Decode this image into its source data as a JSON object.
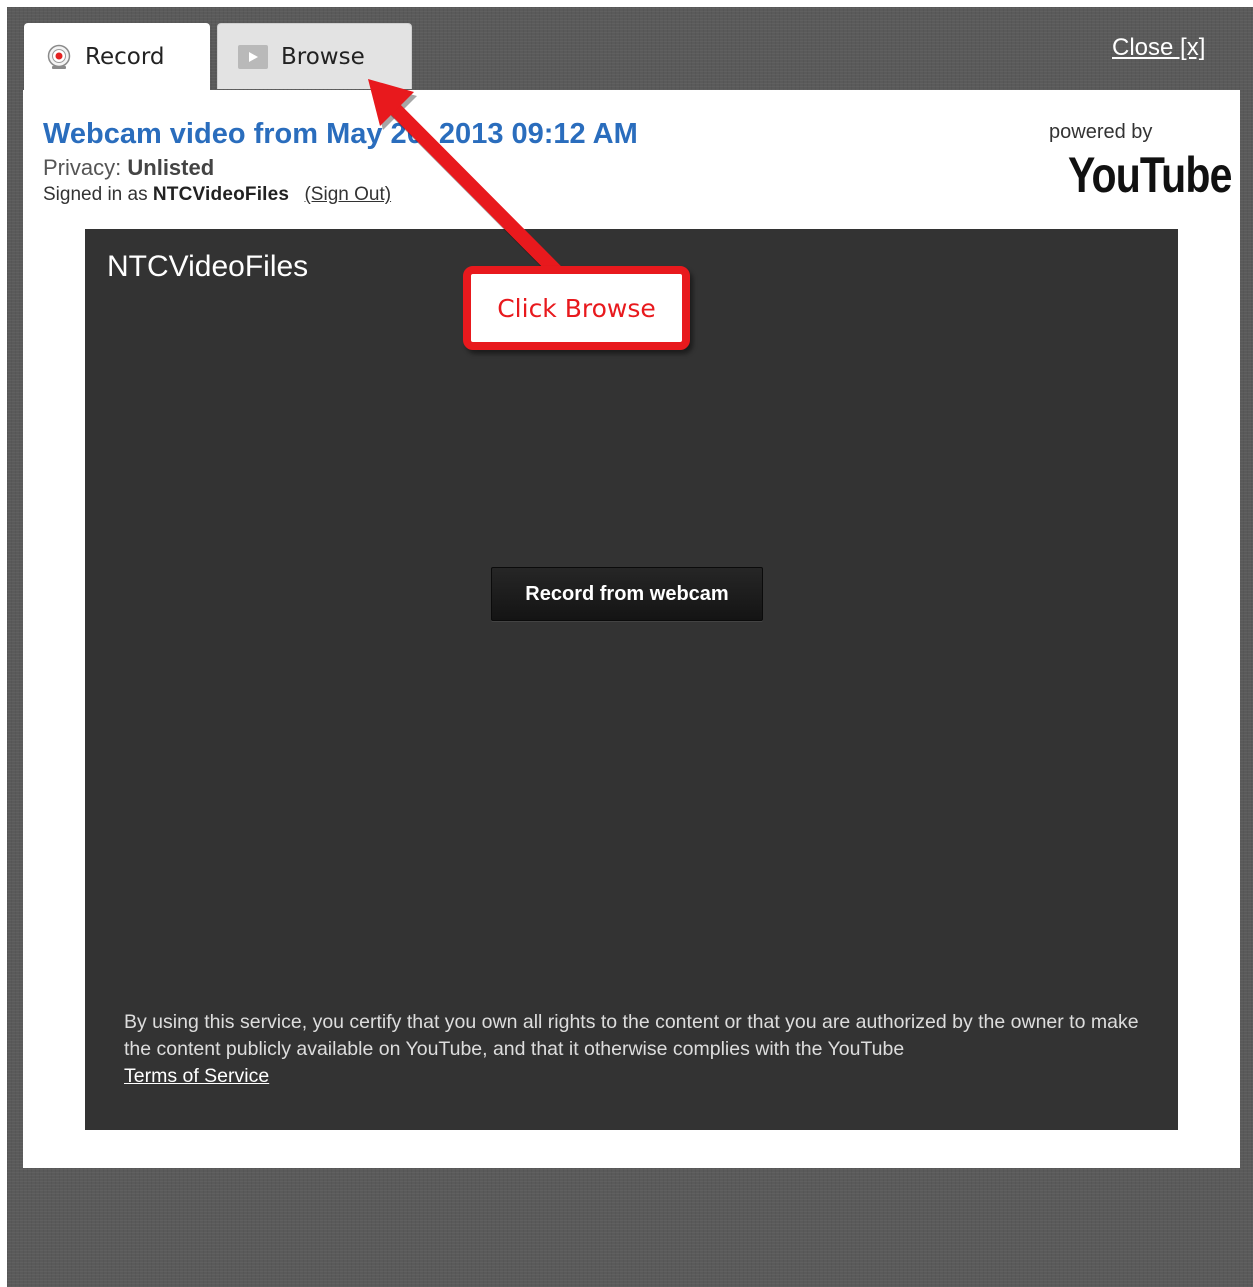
{
  "tabs": {
    "record": {
      "label": "Record",
      "icon": "webcam-record-icon"
    },
    "browse": {
      "label": "Browse",
      "icon": "play-icon"
    }
  },
  "close_link": "Close [x]",
  "header": {
    "title": "Webcam video from May 20, 2013 09:12 AM",
    "privacy_label": "Privacy:",
    "privacy_value": "Unlisted",
    "signed_in_label": "Signed in as",
    "username": "NTCVideoFiles",
    "sign_out": "(Sign Out)",
    "powered_by": "powered by",
    "brand": "YouTube"
  },
  "recorder": {
    "channel_name": "NTCVideoFiles",
    "record_button": "Record from webcam",
    "tos_text": "By using this service, you certify that you own all rights to the content or that you are authorized by the owner to make the content publicly available on YouTube, and that it otherwise complies with the YouTube",
    "tos_link": "Terms of Service"
  },
  "annotation": {
    "callout_text": "Click Browse",
    "color": "#e8191d"
  },
  "colors": {
    "title_blue": "#2a6dbd",
    "recorder_bg": "#333333",
    "frame_bg": "#5a5a5a"
  }
}
